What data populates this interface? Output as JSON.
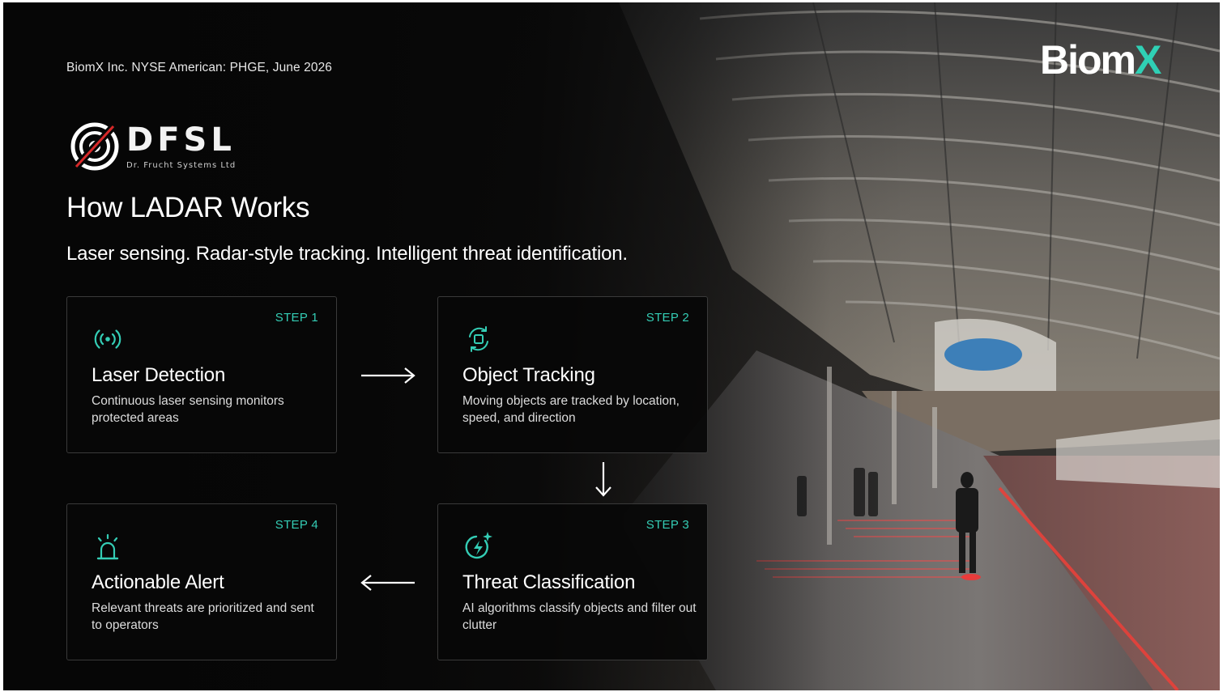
{
  "meta": {
    "line": "BiomX Inc. NYSE American: PHGE, June 2026"
  },
  "brand": {
    "part1": "Biom",
    "part2": "X",
    "accent": "#2fd0b5"
  },
  "logo": {
    "name": "DFSL",
    "sub": "Dr. Frucht Systems Ltd"
  },
  "title": "How LADAR Works",
  "subtitle": "Laser sensing. Radar-style tracking. Intelligent threat identification.",
  "steps": [
    {
      "label": "STEP 1",
      "title": "Laser Detection",
      "desc": "Continuous laser sensing monitors protected areas",
      "icon": "broadcast-icon"
    },
    {
      "label": "STEP 2",
      "title": "Object Tracking",
      "desc": "Moving objects are tracked by location, speed, and direction",
      "icon": "tracking-icon"
    },
    {
      "label": "STEP 3",
      "title": "Threat Classification",
      "desc": "AI algorithms classify objects and filter out clutter",
      "icon": "ai-bolt-icon"
    },
    {
      "label": "STEP 4",
      "title": "Actionable Alert",
      "desc": "Relevant threats are prioritized and sent to operators",
      "icon": "siren-icon"
    }
  ]
}
